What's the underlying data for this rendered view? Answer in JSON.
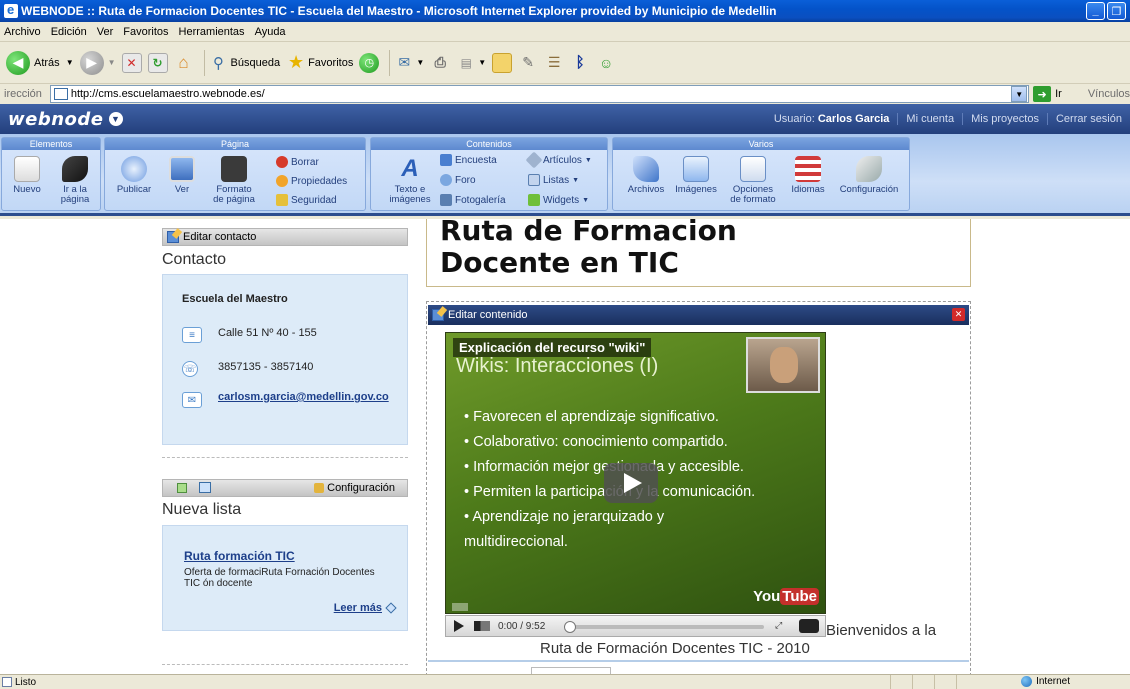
{
  "window": {
    "title": "WEBNODE :: Ruta de Formacion Docentes TIC - Escuela del Maestro - Microsoft Internet Explorer provided by Municipio de Medellin"
  },
  "menu": [
    "Archivo",
    "Edición",
    "Ver",
    "Favoritos",
    "Herramientas",
    "Ayuda"
  ],
  "toolbar": {
    "back_label": "Atrás",
    "search_label": "Búsqueda",
    "favorites_label": "Favoritos"
  },
  "address": {
    "label": "irección",
    "url": "http://cms.escuelamaestro.webnode.es/",
    "go_label": "Ir",
    "links_label": "Vínculos"
  },
  "header": {
    "logo": "webnode",
    "user_prefix": "Usuario:",
    "user_name": "Carlos Garcia",
    "links": [
      "Mi cuenta",
      "Mis proyectos",
      "Cerrar sesión"
    ]
  },
  "ribbon": {
    "groups": {
      "elementos": "Elementos",
      "pagina": "Página",
      "contenidos": "Contenidos",
      "varios": "Varios"
    },
    "nuevo": "Nuevo",
    "ir_a": "Ir a la",
    "ir_a2": "página",
    "publicar": "Publicar",
    "ver": "Ver",
    "formato1": "Formato",
    "formato2": "de página",
    "borrar": "Borrar",
    "propiedades": "Propiedades",
    "seguridad": "Seguridad",
    "texto1": "Texto e",
    "texto2": "imágenes",
    "encuesta": "Encuesta",
    "foro": "Foro",
    "fotogaleria": "Fotogalería",
    "articulos": "Artículos",
    "listas": "Listas",
    "widgets": "Widgets",
    "archivos": "Archivos",
    "imagenes": "Imágenes",
    "opciones1": "Opciones",
    "opciones2": "de formato",
    "idiomas": "Idiomas",
    "configuracion": "Configuración"
  },
  "contact": {
    "edit_label": "Editar contacto",
    "title": "Contacto",
    "org": "Escuela del Maestro",
    "address": "Calle 51 Nº 40 - 155",
    "phone": "3857135 - 3857140",
    "email": "carlosm.garcia@medellin.gov.co"
  },
  "list": {
    "config_label": "Configuración",
    "title": "Nueva lista",
    "item_title": "Ruta formación TIC",
    "item_desc": "Oferta de formaciRuta Fornación Docentes TIC ón docente",
    "more": "Leer más"
  },
  "main": {
    "headline_1": "Ruta de Formacion",
    "headline_2": "Docente en TIC",
    "edit_content_label": "Editar contenido",
    "video_title": "Explicación del recurso \"wiki\"",
    "video_slide_title": "Wikis: Interacciones (I)",
    "video_bullets": [
      "Favorecen el aprendizaje significativo.",
      "Colaborativo: conocimiento compartido.",
      "Información mejor gestionada y accesible.",
      "Permiten la participación y la comunicación.",
      "Aprendizaje no jerarquizado y multidireccional."
    ],
    "youtube_a": "You",
    "youtube_b": "Tube",
    "time": "0:00 / 9:52",
    "welcome_1": "Bienvenidos a la",
    "welcome_2": "Ruta de Formación Docentes TIC - 2010"
  },
  "status": {
    "left": "Listo",
    "zone": "Internet"
  }
}
